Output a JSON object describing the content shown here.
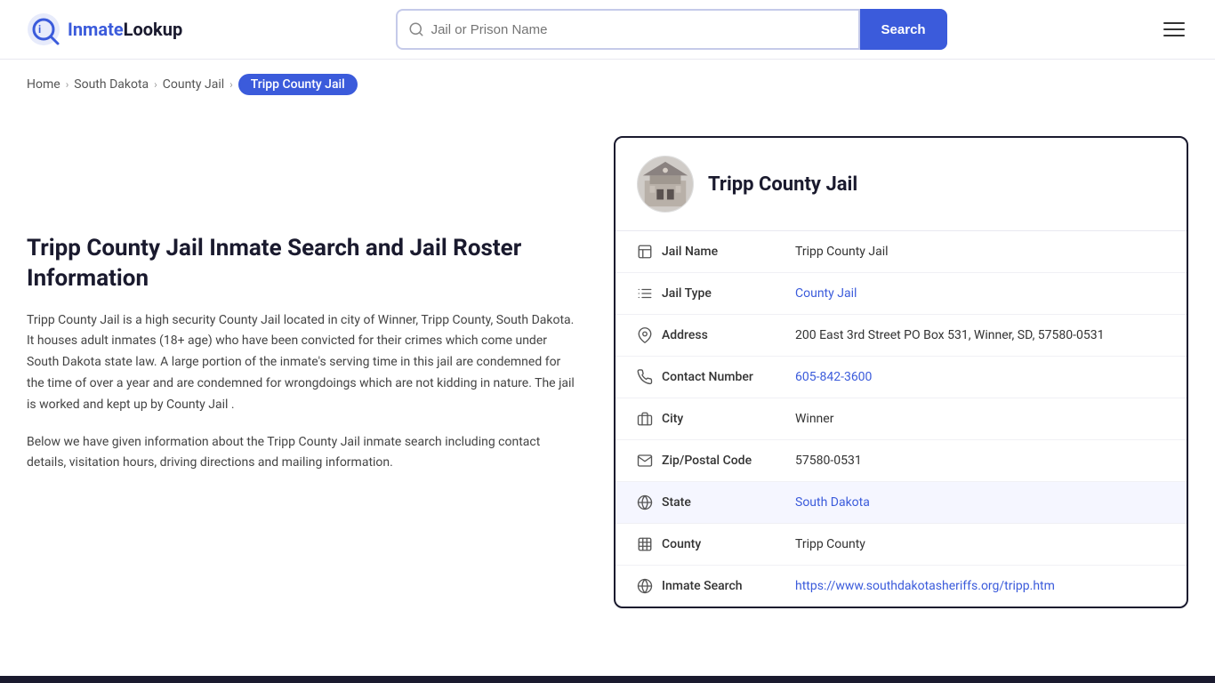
{
  "header": {
    "logo_text_part1": "Inmate",
    "logo_text_part2": "Lookup",
    "search_placeholder": "Jail or Prison Name",
    "search_btn_label": "Search"
  },
  "breadcrumb": {
    "home": "Home",
    "state": "South Dakota",
    "type": "County Jail",
    "current": "Tripp County Jail"
  },
  "left": {
    "title": "Tripp County Jail Inmate Search and Jail Roster Information",
    "desc1": "Tripp County Jail is a high security County Jail located in city of Winner, Tripp County, South Dakota. It houses adult inmates (18+ age) who have been convicted for their crimes which come under South Dakota state law. A large portion of the inmate's serving time in this jail are condemned for the time of over a year and are condemned for wrongdoings which are not kidding in nature. The jail is worked and kept up by County Jail .",
    "desc2": "Below we have given information about the Tripp County Jail inmate search including contact details, visitation hours, driving directions and mailing information."
  },
  "card": {
    "name": "Tripp County Jail",
    "fields": {
      "jail_name_label": "Jail Name",
      "jail_name_value": "Tripp County Jail",
      "jail_type_label": "Jail Type",
      "jail_type_value": "County Jail",
      "jail_type_link": "#",
      "address_label": "Address",
      "address_value": "200 East 3rd Street PO Box 531, Winner, SD, 57580-0531",
      "contact_label": "Contact Number",
      "contact_value": "605-842-3600",
      "contact_link": "tel:605-842-3600",
      "city_label": "City",
      "city_value": "Winner",
      "zip_label": "Zip/Postal Code",
      "zip_value": "57580-0531",
      "state_label": "State",
      "state_value": "South Dakota",
      "state_link": "#",
      "county_label": "County",
      "county_value": "Tripp County",
      "inmate_label": "Inmate Search",
      "inmate_link": "https://www.southdakotasheriffs.org/tripp.htm",
      "inmate_value": "https://www.southdakotasheriffs.org/tripp.htm"
    }
  }
}
